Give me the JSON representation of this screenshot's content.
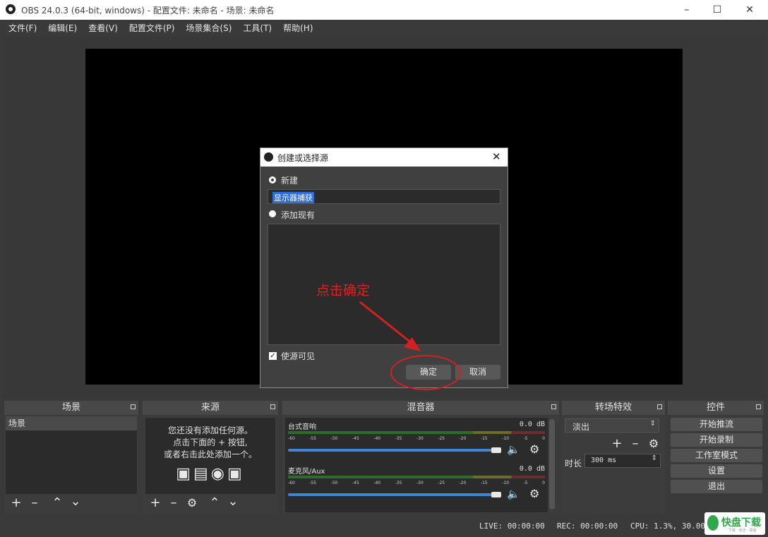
{
  "window": {
    "title": "OBS 24.0.3 (64-bit, windows) - 配置文件: 未命名 - 场景: 未命名"
  },
  "menu": [
    "文件(F)",
    "编辑(E)",
    "查看(V)",
    "配置文件(P)",
    "场景集合(S)",
    "工具(T)",
    "帮助(H)"
  ],
  "docks": {
    "scenes": {
      "title": "场景",
      "items": [
        "场景"
      ]
    },
    "sources": {
      "title": "来源",
      "empty_line1": "您还没有添加任何源。",
      "empty_line2": "点击下面的 + 按钮,",
      "empty_line3": "或者右击此处添加一个。"
    },
    "mixer": {
      "title": "混音器",
      "tracks": [
        {
          "name": "台式音响",
          "db": "0.0 dB",
          "volume": 1.0
        },
        {
          "name": "麦克风/Aux",
          "db": "0.0 dB",
          "volume": 1.0
        }
      ],
      "ticks": [
        "-60",
        "-55",
        "-50",
        "-45",
        "-40",
        "-35",
        "-30",
        "-25",
        "-20",
        "-15",
        "-10",
        "-5",
        "0"
      ]
    },
    "transitions": {
      "title": "转场特效",
      "selected": "淡出",
      "duration_label": "时长",
      "duration_value": "300 ms"
    },
    "controls": {
      "title": "控件",
      "buttons": [
        "开始推流",
        "开始录制",
        "工作室模式",
        "设置",
        "退出"
      ]
    }
  },
  "status": {
    "live": "LIVE: 00:00:00",
    "rec": "REC: 00:00:00",
    "cpu": "CPU: 1.3%, 30.00 fps"
  },
  "dialog": {
    "title": "创建或选择源",
    "option_new": "新建",
    "name_value": "显示器捕获",
    "option_existing": "添加现有",
    "visible_label": "使源可见",
    "visible_checked": true,
    "ok": "确定",
    "cancel": "取消"
  },
  "annotation": {
    "text": "点击确定",
    "color": "#e02020"
  },
  "watermark": {
    "text": "快盘下载",
    "sub": "下载 · 安全 · 高速"
  },
  "colors": {
    "bg": "#3a3a3a",
    "panel": "#484848",
    "list": "#2b2b2b",
    "accent_blue": "#3f84d8",
    "highlight": "#2f6ed8"
  }
}
